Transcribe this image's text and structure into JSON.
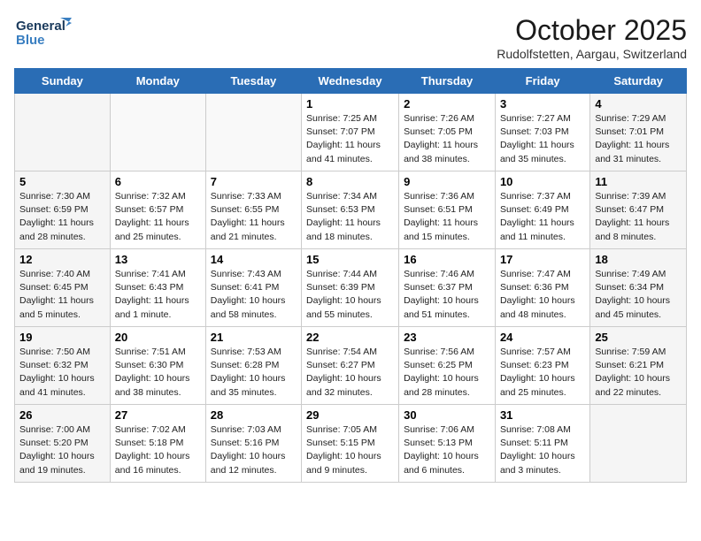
{
  "header": {
    "logo_line1": "General",
    "logo_line2": "Blue",
    "month": "October 2025",
    "location": "Rudolfstetten, Aargau, Switzerland"
  },
  "days_of_week": [
    "Sunday",
    "Monday",
    "Tuesday",
    "Wednesday",
    "Thursday",
    "Friday",
    "Saturday"
  ],
  "weeks": [
    [
      {
        "day": "",
        "info": ""
      },
      {
        "day": "",
        "info": ""
      },
      {
        "day": "",
        "info": ""
      },
      {
        "day": "1",
        "info": "Sunrise: 7:25 AM\nSunset: 7:07 PM\nDaylight: 11 hours\nand 41 minutes."
      },
      {
        "day": "2",
        "info": "Sunrise: 7:26 AM\nSunset: 7:05 PM\nDaylight: 11 hours\nand 38 minutes."
      },
      {
        "day": "3",
        "info": "Sunrise: 7:27 AM\nSunset: 7:03 PM\nDaylight: 11 hours\nand 35 minutes."
      },
      {
        "day": "4",
        "info": "Sunrise: 7:29 AM\nSunset: 7:01 PM\nDaylight: 11 hours\nand 31 minutes."
      }
    ],
    [
      {
        "day": "5",
        "info": "Sunrise: 7:30 AM\nSunset: 6:59 PM\nDaylight: 11 hours\nand 28 minutes."
      },
      {
        "day": "6",
        "info": "Sunrise: 7:32 AM\nSunset: 6:57 PM\nDaylight: 11 hours\nand 25 minutes."
      },
      {
        "day": "7",
        "info": "Sunrise: 7:33 AM\nSunset: 6:55 PM\nDaylight: 11 hours\nand 21 minutes."
      },
      {
        "day": "8",
        "info": "Sunrise: 7:34 AM\nSunset: 6:53 PM\nDaylight: 11 hours\nand 18 minutes."
      },
      {
        "day": "9",
        "info": "Sunrise: 7:36 AM\nSunset: 6:51 PM\nDaylight: 11 hours\nand 15 minutes."
      },
      {
        "day": "10",
        "info": "Sunrise: 7:37 AM\nSunset: 6:49 PM\nDaylight: 11 hours\nand 11 minutes."
      },
      {
        "day": "11",
        "info": "Sunrise: 7:39 AM\nSunset: 6:47 PM\nDaylight: 11 hours\nand 8 minutes."
      }
    ],
    [
      {
        "day": "12",
        "info": "Sunrise: 7:40 AM\nSunset: 6:45 PM\nDaylight: 11 hours\nand 5 minutes."
      },
      {
        "day": "13",
        "info": "Sunrise: 7:41 AM\nSunset: 6:43 PM\nDaylight: 11 hours\nand 1 minute."
      },
      {
        "day": "14",
        "info": "Sunrise: 7:43 AM\nSunset: 6:41 PM\nDaylight: 10 hours\nand 58 minutes."
      },
      {
        "day": "15",
        "info": "Sunrise: 7:44 AM\nSunset: 6:39 PM\nDaylight: 10 hours\nand 55 minutes."
      },
      {
        "day": "16",
        "info": "Sunrise: 7:46 AM\nSunset: 6:37 PM\nDaylight: 10 hours\nand 51 minutes."
      },
      {
        "day": "17",
        "info": "Sunrise: 7:47 AM\nSunset: 6:36 PM\nDaylight: 10 hours\nand 48 minutes."
      },
      {
        "day": "18",
        "info": "Sunrise: 7:49 AM\nSunset: 6:34 PM\nDaylight: 10 hours\nand 45 minutes."
      }
    ],
    [
      {
        "day": "19",
        "info": "Sunrise: 7:50 AM\nSunset: 6:32 PM\nDaylight: 10 hours\nand 41 minutes."
      },
      {
        "day": "20",
        "info": "Sunrise: 7:51 AM\nSunset: 6:30 PM\nDaylight: 10 hours\nand 38 minutes."
      },
      {
        "day": "21",
        "info": "Sunrise: 7:53 AM\nSunset: 6:28 PM\nDaylight: 10 hours\nand 35 minutes."
      },
      {
        "day": "22",
        "info": "Sunrise: 7:54 AM\nSunset: 6:27 PM\nDaylight: 10 hours\nand 32 minutes."
      },
      {
        "day": "23",
        "info": "Sunrise: 7:56 AM\nSunset: 6:25 PM\nDaylight: 10 hours\nand 28 minutes."
      },
      {
        "day": "24",
        "info": "Sunrise: 7:57 AM\nSunset: 6:23 PM\nDaylight: 10 hours\nand 25 minutes."
      },
      {
        "day": "25",
        "info": "Sunrise: 7:59 AM\nSunset: 6:21 PM\nDaylight: 10 hours\nand 22 minutes."
      }
    ],
    [
      {
        "day": "26",
        "info": "Sunrise: 7:00 AM\nSunset: 5:20 PM\nDaylight: 10 hours\nand 19 minutes."
      },
      {
        "day": "27",
        "info": "Sunrise: 7:02 AM\nSunset: 5:18 PM\nDaylight: 10 hours\nand 16 minutes."
      },
      {
        "day": "28",
        "info": "Sunrise: 7:03 AM\nSunset: 5:16 PM\nDaylight: 10 hours\nand 12 minutes."
      },
      {
        "day": "29",
        "info": "Sunrise: 7:05 AM\nSunset: 5:15 PM\nDaylight: 10 hours\nand 9 minutes."
      },
      {
        "day": "30",
        "info": "Sunrise: 7:06 AM\nSunset: 5:13 PM\nDaylight: 10 hours\nand 6 minutes."
      },
      {
        "day": "31",
        "info": "Sunrise: 7:08 AM\nSunset: 5:11 PM\nDaylight: 10 hours\nand 3 minutes."
      },
      {
        "day": "",
        "info": ""
      }
    ]
  ]
}
